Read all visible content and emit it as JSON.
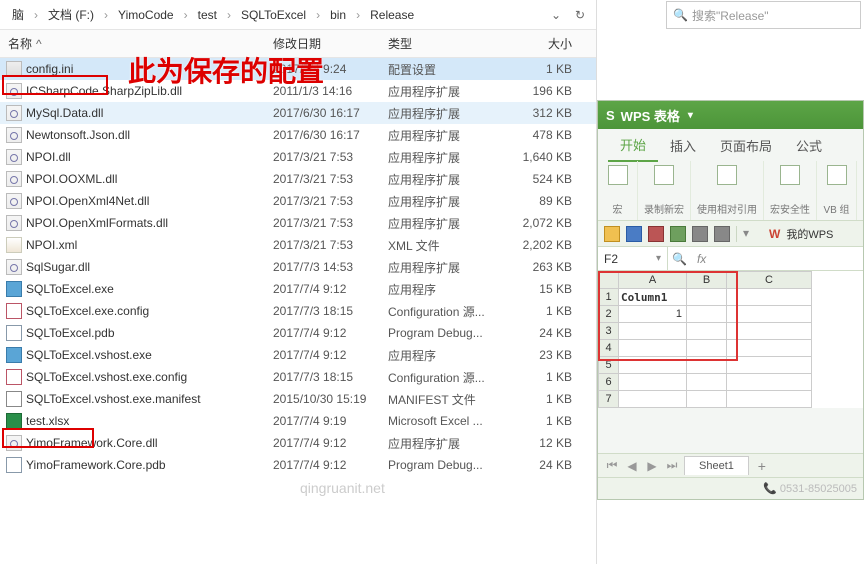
{
  "breadcrumb": [
    "脑",
    "文档 (F:)",
    "YimoCode",
    "test",
    "SQLToExcel",
    "bin",
    "Release"
  ],
  "columns": {
    "name": "名称",
    "date": "修改日期",
    "type": "类型",
    "size": "大小"
  },
  "search_placeholder": "搜索\"Release\"",
  "annotation": "此为保存的配置",
  "files": [
    {
      "name": "config.ini",
      "date": "2017/7/4 9:24",
      "type": "配置设置",
      "size": "1 KB",
      "ico": "ini",
      "sel": true
    },
    {
      "name": "ICSharpCode.SharpZipLib.dll",
      "date": "2011/1/3 14:16",
      "type": "应用程序扩展",
      "size": "196 KB",
      "ico": "dll"
    },
    {
      "name": "MySql.Data.dll",
      "date": "2017/6/30 16:17",
      "type": "应用程序扩展",
      "size": "312 KB",
      "ico": "dll",
      "hov": true
    },
    {
      "name": "Newtonsoft.Json.dll",
      "date": "2017/6/30 16:17",
      "type": "应用程序扩展",
      "size": "478 KB",
      "ico": "dll"
    },
    {
      "name": "NPOI.dll",
      "date": "2017/3/21 7:53",
      "type": "应用程序扩展",
      "size": "1,640 KB",
      "ico": "dll"
    },
    {
      "name": "NPOI.OOXML.dll",
      "date": "2017/3/21 7:53",
      "type": "应用程序扩展",
      "size": "524 KB",
      "ico": "dll"
    },
    {
      "name": "NPOI.OpenXml4Net.dll",
      "date": "2017/3/21 7:53",
      "type": "应用程序扩展",
      "size": "89 KB",
      "ico": "dll"
    },
    {
      "name": "NPOI.OpenXmlFormats.dll",
      "date": "2017/3/21 7:53",
      "type": "应用程序扩展",
      "size": "2,072 KB",
      "ico": "dll"
    },
    {
      "name": "NPOI.xml",
      "date": "2017/3/21 7:53",
      "type": "XML 文件",
      "size": "2,202 KB",
      "ico": "xml"
    },
    {
      "name": "SqlSugar.dll",
      "date": "2017/7/3 14:53",
      "type": "应用程序扩展",
      "size": "263 KB",
      "ico": "dll"
    },
    {
      "name": "SQLToExcel.exe",
      "date": "2017/7/4 9:12",
      "type": "应用程序",
      "size": "15 KB",
      "ico": "exe"
    },
    {
      "name": "SQLToExcel.exe.config",
      "date": "2017/7/3 18:15",
      "type": "Configuration 源...",
      "size": "1 KB",
      "ico": "cfg"
    },
    {
      "name": "SQLToExcel.pdb",
      "date": "2017/7/4 9:12",
      "type": "Program Debug...",
      "size": "24 KB",
      "ico": "pdb"
    },
    {
      "name": "SQLToExcel.vshost.exe",
      "date": "2017/7/4 9:12",
      "type": "应用程序",
      "size": "23 KB",
      "ico": "exe"
    },
    {
      "name": "SQLToExcel.vshost.exe.config",
      "date": "2017/7/3 18:15",
      "type": "Configuration 源...",
      "size": "1 KB",
      "ico": "cfg"
    },
    {
      "name": "SQLToExcel.vshost.exe.manifest",
      "date": "2015/10/30 15:19",
      "type": "MANIFEST 文件",
      "size": "1 KB",
      "ico": "man"
    },
    {
      "name": "test.xlsx",
      "date": "2017/7/4 9:19",
      "type": "Microsoft Excel ...",
      "size": "1 KB",
      "ico": "xlsx"
    },
    {
      "name": "YimoFramework.Core.dll",
      "date": "2017/7/4 9:12",
      "type": "应用程序扩展",
      "size": "12 KB",
      "ico": "dll"
    },
    {
      "name": "YimoFramework.Core.pdb",
      "date": "2017/7/4 9:12",
      "type": "Program Debug...",
      "size": "24 KB",
      "ico": "pdb"
    }
  ],
  "wps": {
    "title": "WPS 表格",
    "tabs": [
      "开始",
      "插入",
      "页面布局",
      "公式"
    ],
    "ribbon": [
      "宏",
      "录制新宏",
      "使用相对引用",
      "宏安全性",
      "VB 组"
    ],
    "mywps": "我的WPS",
    "namebox": "F2",
    "fx": "fx",
    "grid_cols": [
      "A",
      "B",
      "C"
    ],
    "grid_rows": [
      "1",
      "2",
      "3",
      "4",
      "5",
      "6",
      "7"
    ],
    "cell_a1": "Column1",
    "cell_a2": "1",
    "sheet": "Sheet1",
    "status_phone": "0531-85025005"
  },
  "watermark": "qingruanit.net",
  "chart_data": {
    "type": "table",
    "title": "Sheet1",
    "columns": [
      "A",
      "B",
      "C"
    ],
    "rows": [
      {
        "A": "Column1",
        "B": "",
        "C": ""
      },
      {
        "A": 1,
        "B": "",
        "C": ""
      }
    ]
  }
}
